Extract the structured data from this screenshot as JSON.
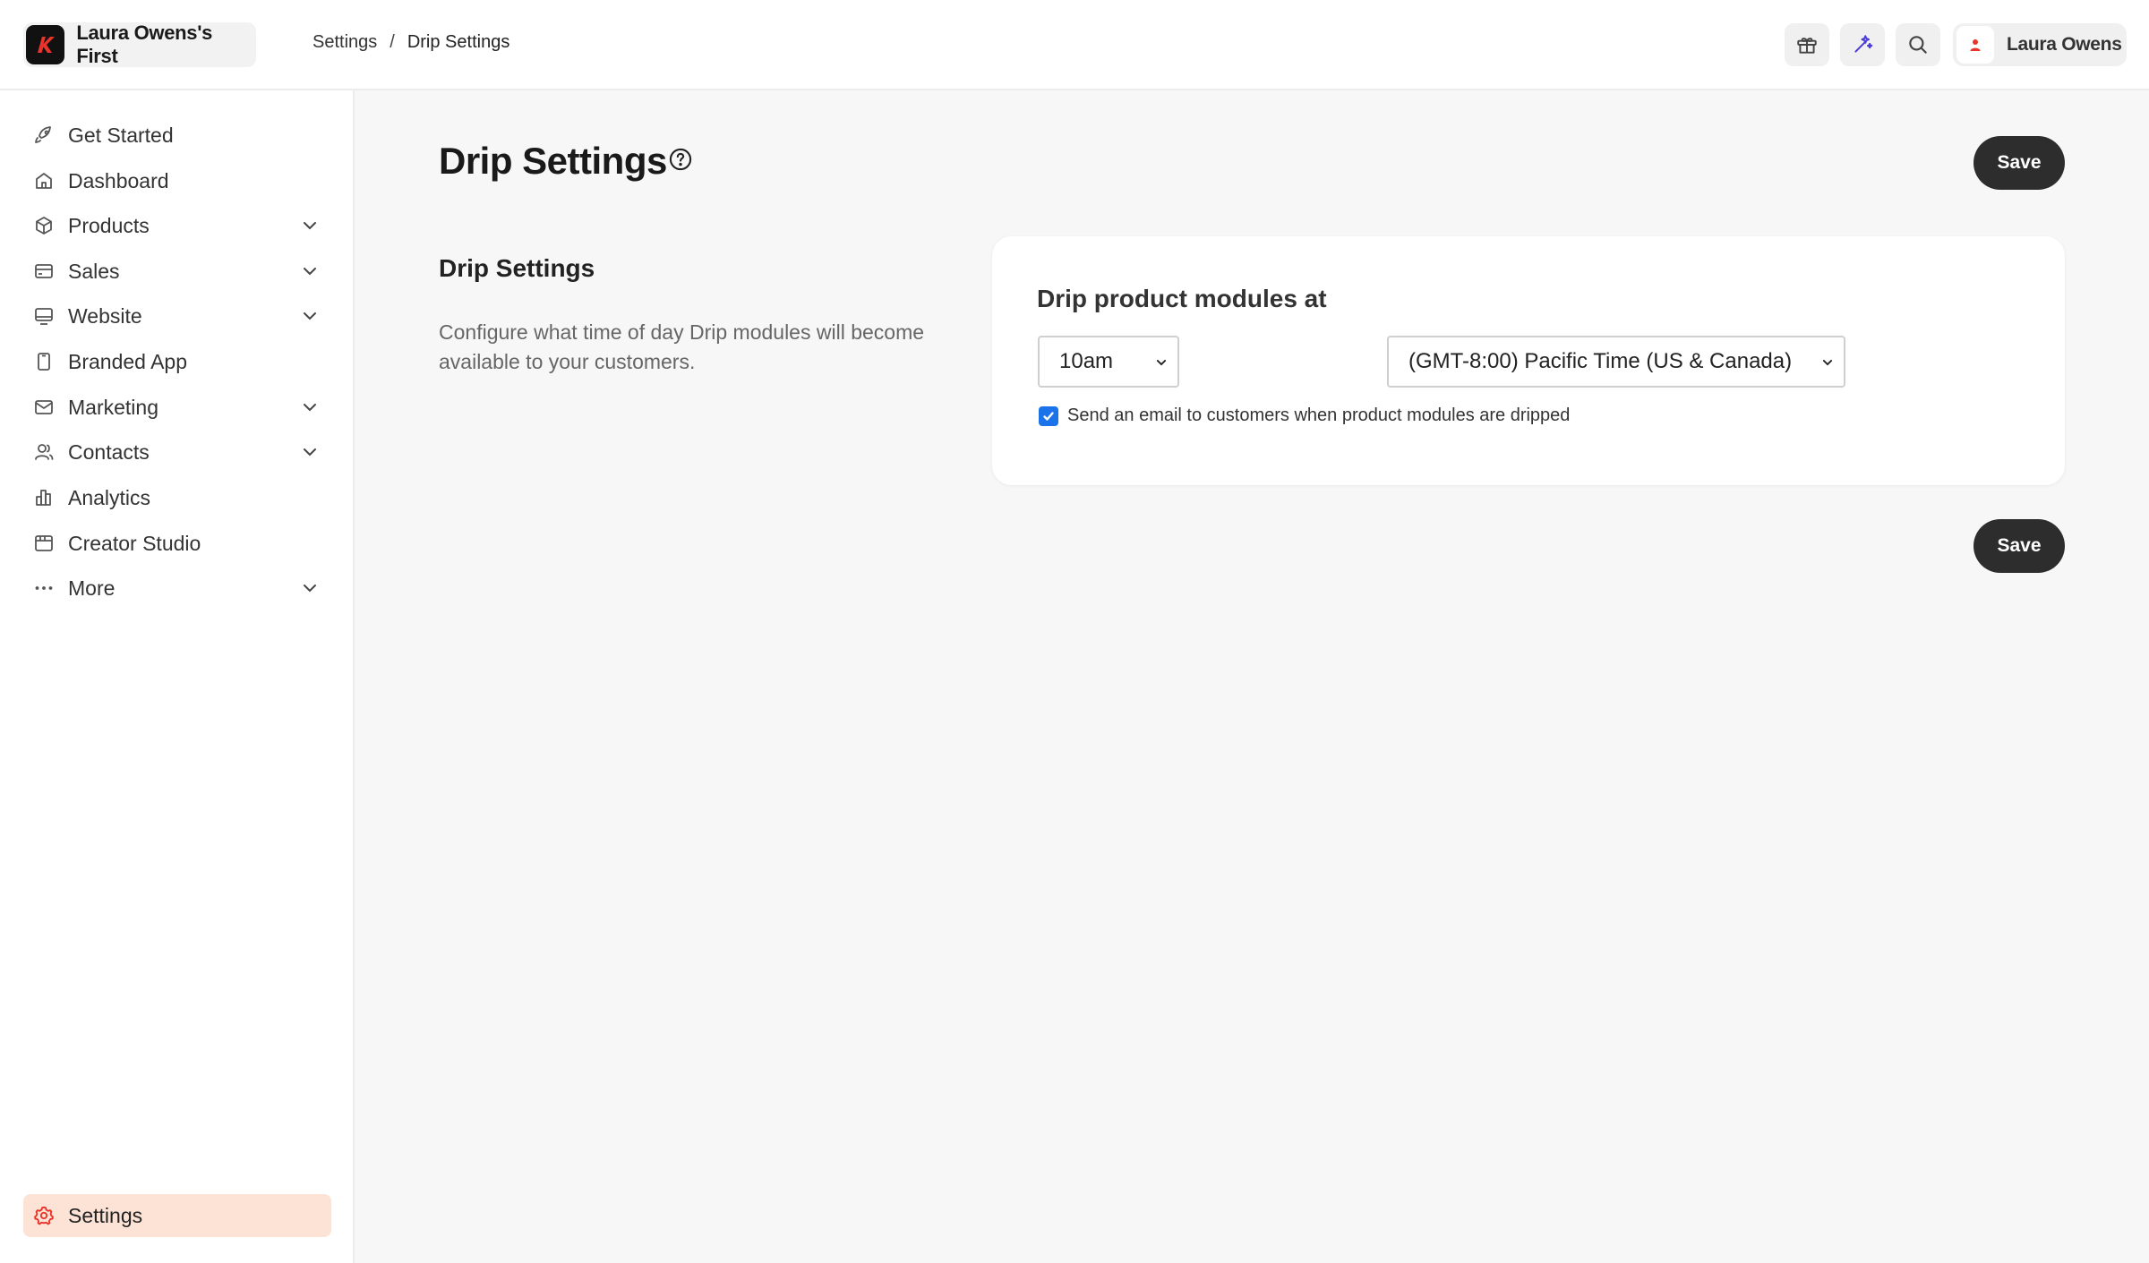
{
  "brand": {
    "name": "Laura Owens's First",
    "logo_color": "#e8342a"
  },
  "breadcrumb": {
    "parent": "Settings",
    "separator": "/",
    "current": "Drip Settings"
  },
  "topbar": {
    "icons": [
      "gift-icon",
      "sparkle-icon",
      "search-icon"
    ],
    "sparkle_color": "#4a3ad6",
    "user_name": "Laura Owens"
  },
  "sidebar": {
    "items": [
      {
        "label": "Get Started",
        "icon": "rocket-icon",
        "has_chevron": false
      },
      {
        "label": "Dashboard",
        "icon": "home-icon",
        "has_chevron": false
      },
      {
        "label": "Products",
        "icon": "box-icon",
        "has_chevron": true
      },
      {
        "label": "Sales",
        "icon": "credit-card-icon",
        "has_chevron": true
      },
      {
        "label": "Website",
        "icon": "monitor-icon",
        "has_chevron": true
      },
      {
        "label": "Branded App",
        "icon": "mobile-icon",
        "has_chevron": false
      },
      {
        "label": "Marketing",
        "icon": "mail-icon",
        "has_chevron": true
      },
      {
        "label": "Contacts",
        "icon": "users-icon",
        "has_chevron": true
      },
      {
        "label": "Analytics",
        "icon": "bar-chart-icon",
        "has_chevron": false
      },
      {
        "label": "Creator Studio",
        "icon": "calendar-icon",
        "has_chevron": false
      },
      {
        "label": "More",
        "icon": "dots-icon",
        "has_chevron": true
      }
    ],
    "settings_label": "Settings",
    "settings_active_bg": "#fde3d6",
    "settings_icon_color": "#e8342a"
  },
  "main": {
    "title": "Drip Settings",
    "save_label": "Save",
    "section_title": "Drip Settings",
    "section_description": "Configure what time of day Drip modules will become available to your customers.",
    "card": {
      "title": "Drip product modules at",
      "time_value": "10am",
      "timezone_value": "(GMT-8:00) Pacific Time (US & Canada)",
      "email_checkbox_checked": true,
      "email_checkbox_label": "Send an email to customers when product modules are dripped"
    }
  }
}
